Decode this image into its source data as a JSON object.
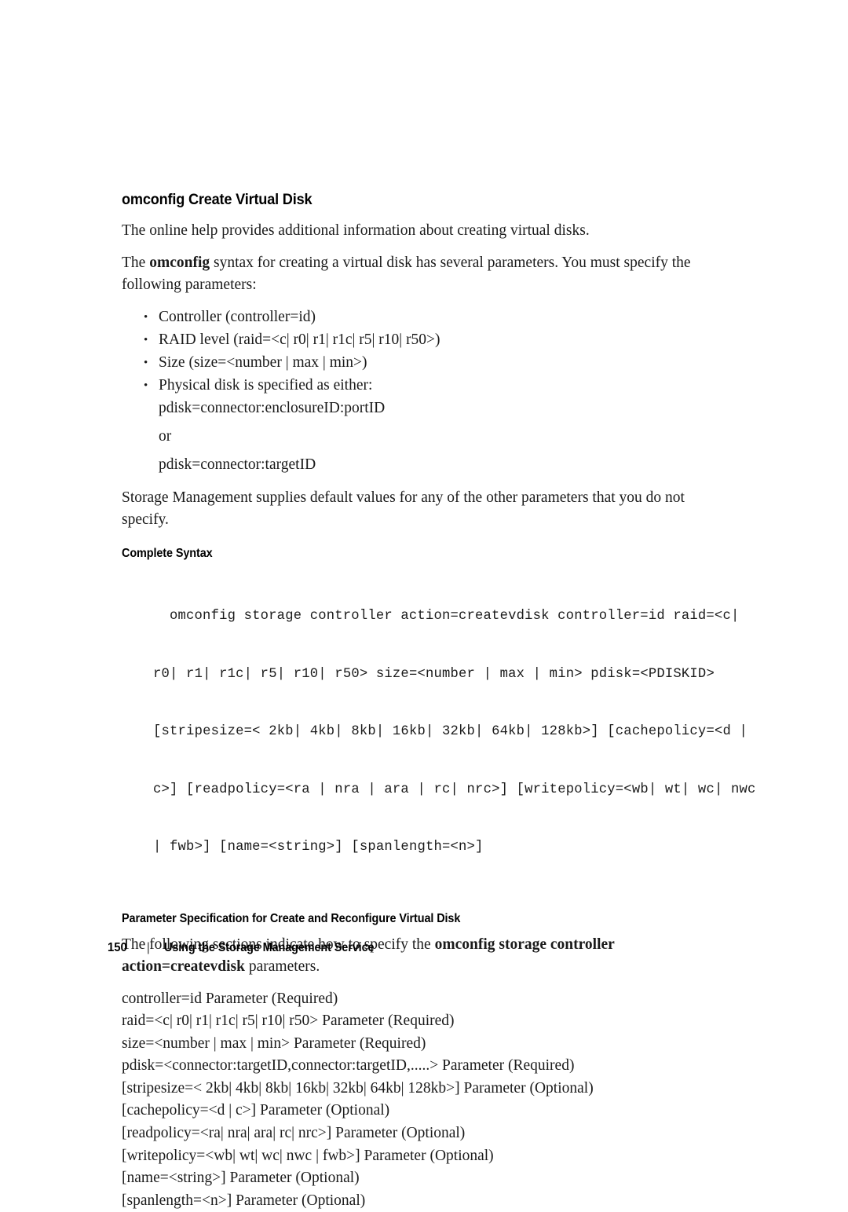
{
  "document": {
    "section_heading": "omconfig Create Virtual Disk",
    "intro_paragraph": "The online help provides additional information about creating virtual disks.",
    "syntax_paragraph": {
      "before": "The ",
      "bold": "omconfig",
      "after": " syntax for creating a virtual disk has several parameters. You must specify the following parameters:"
    },
    "bullets": [
      "Controller (controller=id)",
      "RAID level (raid=<c| r0| r1| r1c| r5| r10| r50>)",
      "Size (size=<number | max | min>)",
      "Physical disk is specified as either:"
    ],
    "bullet_sub_lines": [
      "pdisk=connector:enclosureID:portID",
      "or",
      "pdisk=connector:targetID"
    ],
    "defaults_paragraph": "Storage Management supplies default values for any of the other parameters that you do not specify.",
    "complete_syntax_heading": "Complete Syntax",
    "complete_syntax_code": [
      "omconfig storage controller action=createvdisk controller=id raid=<c|",
      "r0| r1| r1c| r5| r10| r50> size=<number | max | min> pdisk=<PDISKID>",
      "[stripesize=< 2kb| 4kb| 8kb| 16kb| 32kb| 64kb| 128kb>] [cachepolicy=<d |",
      "c>] [readpolicy=<ra | nra | ara | rc| nrc>] [writepolicy=<wb| wt| wc| nwc",
      "| fwb>] [name=<string>] [spanlength=<n>]"
    ],
    "param_spec_heading": "Parameter Specification for Create and Reconfigure Virtual Disk",
    "param_spec_paragraph": {
      "before": "The following sections indicate how to specify the ",
      "bold": "omconfig storage controller action=createvdisk",
      "after": " parameters."
    },
    "parameter_lines": [
      "controller=id Parameter (Required)",
      "raid=<c| r0| r1| r1c| r5| r10| r50> Parameter (Required)",
      "size=<number | max | min> Parameter (Required)",
      "pdisk=<connector:targetID,connector:targetID,.....> Parameter (Required)",
      "[stripesize=< 2kb| 4kb| 8kb| 16kb| 32kb| 64kb| 128kb>] Parameter (Optional)",
      "[cachepolicy=<d | c>] Parameter (Optional)",
      "[readpolicy=<ra| nra| ara| rc| nrc>] Parameter (Optional)",
      "[writepolicy=<wb| wt| wc| nwc | fwb>] Parameter (Optional)",
      "[name=<string>] Parameter (Optional)",
      "[spanlength=<n>] Parameter (Optional)"
    ],
    "footer": {
      "page_number": "150",
      "separator": "|",
      "title": "Using the Storage Management Service"
    }
  }
}
